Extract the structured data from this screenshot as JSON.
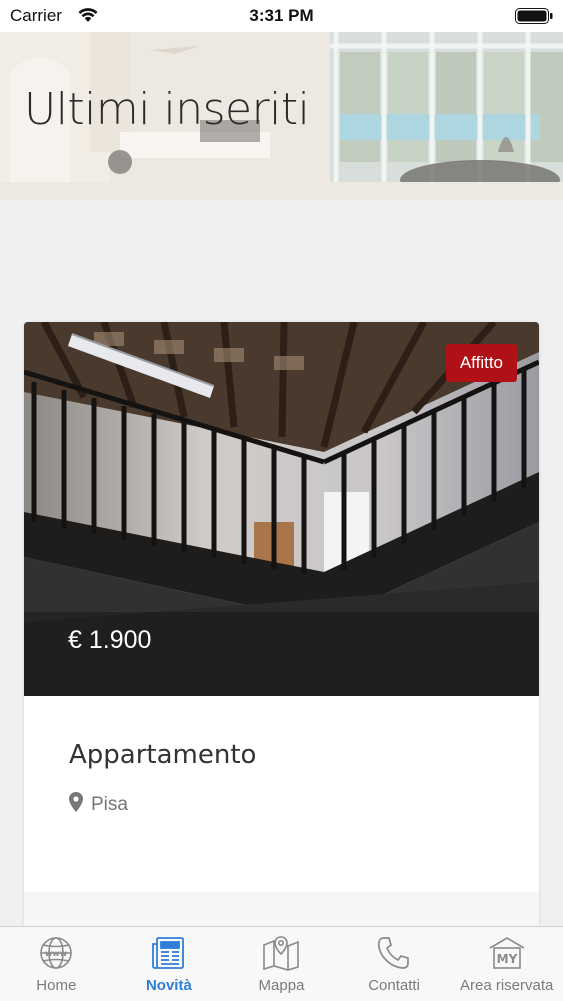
{
  "status_bar": {
    "carrier": "Carrier",
    "time": "3:31 PM",
    "wifi_icon": "wifi-icon",
    "battery_icon": "battery-icon"
  },
  "hero": {
    "title": "Ultimi inseriti"
  },
  "listing": {
    "badge": "Affitto",
    "badge_color": "#b01116",
    "price": "€ 1.900",
    "title": "Appartamento",
    "location": "Pisa",
    "location_icon": "map-pin-icon"
  },
  "tab_bar": {
    "active_color": "#2f7fd6",
    "items": [
      {
        "label": "Home",
        "icon": "globe-icon"
      },
      {
        "label": "Novità",
        "icon": "newspaper-icon",
        "active": true
      },
      {
        "label": "Mappa",
        "icon": "map-icon"
      },
      {
        "label": "Contatti",
        "icon": "phone-icon"
      },
      {
        "label": "Area riservata",
        "icon": "my-area-icon"
      }
    ]
  }
}
